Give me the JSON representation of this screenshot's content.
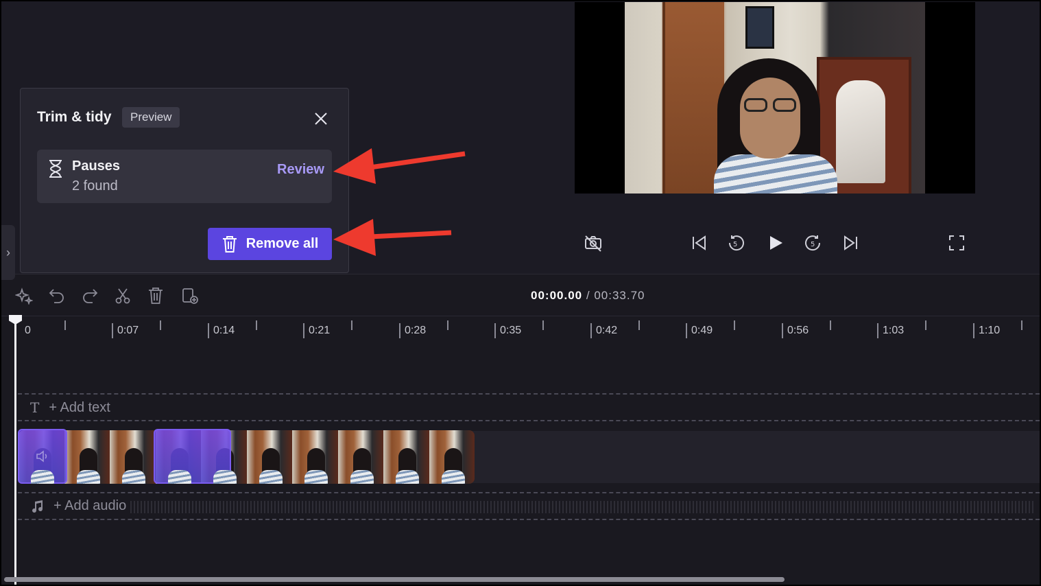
{
  "panel": {
    "title": "Trim & tidy",
    "badge": "Preview",
    "card": {
      "title": "Pauses",
      "subtitle": "2 found",
      "action": "Review"
    },
    "remove_button": "Remove all"
  },
  "toolbar": {
    "current_time": "00:00.00",
    "separator": "/",
    "total_time": "00:33.70"
  },
  "ruler": {
    "labels": [
      "0",
      "0:07",
      "0:14",
      "0:21",
      "0:28",
      "0:35",
      "0:42",
      "0:49",
      "0:56",
      "1:03",
      "1:10"
    ]
  },
  "tracks": {
    "text_track": "+ Add text",
    "audio_track": "+ Add audio"
  },
  "colors": {
    "accent": "#5b45e0",
    "review_link": "#a89af7",
    "annotation_arrow": "#ee3a2e"
  }
}
